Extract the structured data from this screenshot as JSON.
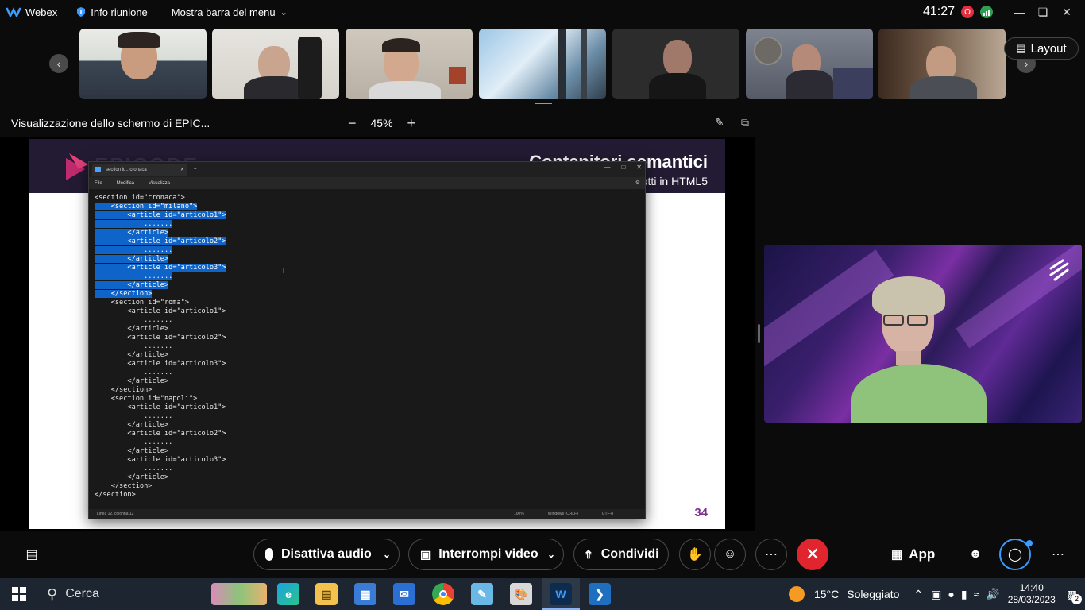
{
  "titlebar": {
    "app_name": "Webex",
    "meeting_info": "Info riunione",
    "menu_bar": "Mostra barra del menu",
    "timer": "41:27",
    "rec_badge": "O"
  },
  "strip": {
    "layout_label": "Layout"
  },
  "share": {
    "header": "Visualizzazione dello schermo di EPIC...",
    "zoom": "45%"
  },
  "slide": {
    "brand": "EPICODE",
    "title": "Contenitori semantici",
    "subtitle": "otti in HTML5",
    "page_number": "34"
  },
  "notepad": {
    "tab_title": "section id...cronaca",
    "menu": [
      "File",
      "Modifica",
      "Visualizza"
    ],
    "code": [
      {
        "indent": "",
        "text": "<section id=\"cronaca\">",
        "sel": false
      },
      {
        "indent": "    ",
        "text": "<section id=\"milano\">",
        "sel": true
      },
      {
        "indent": "        ",
        "text": "<article id=\"articolo1\">",
        "sel": true
      },
      {
        "indent": "            ",
        "text": ".......",
        "sel": true
      },
      {
        "indent": "        ",
        "text": "</article>",
        "sel": true
      },
      {
        "indent": "        ",
        "text": "<article id=\"articolo2\">",
        "sel": true
      },
      {
        "indent": "            ",
        "text": ".......",
        "sel": true
      },
      {
        "indent": "        ",
        "text": "</article>",
        "sel": true
      },
      {
        "indent": "        ",
        "text": "<article id=\"articolo3\">",
        "sel": true
      },
      {
        "indent": "            ",
        "text": ".......",
        "sel": true
      },
      {
        "indent": "        ",
        "text": "</article>",
        "sel": true
      },
      {
        "indent": "    ",
        "text": "</section>",
        "sel": true
      },
      {
        "indent": "    ",
        "text": "<section id=\"roma\">",
        "sel": false
      },
      {
        "indent": "        ",
        "text": "<article id=\"articolo1\">",
        "sel": false
      },
      {
        "indent": "            ",
        "text": ".......",
        "sel": false
      },
      {
        "indent": "        ",
        "text": "</article>",
        "sel": false
      },
      {
        "indent": "        ",
        "text": "<article id=\"articolo2\">",
        "sel": false
      },
      {
        "indent": "            ",
        "text": ".......",
        "sel": false
      },
      {
        "indent": "        ",
        "text": "</article>",
        "sel": false
      },
      {
        "indent": "        ",
        "text": "<article id=\"articolo3\">",
        "sel": false
      },
      {
        "indent": "            ",
        "text": ".......",
        "sel": false
      },
      {
        "indent": "        ",
        "text": "</article>",
        "sel": false
      },
      {
        "indent": "    ",
        "text": "</section>",
        "sel": false
      },
      {
        "indent": "    ",
        "text": "<section id=\"napoli\">",
        "sel": false
      },
      {
        "indent": "        ",
        "text": "<article id=\"articolo1\">",
        "sel": false
      },
      {
        "indent": "            ",
        "text": ".......",
        "sel": false
      },
      {
        "indent": "        ",
        "text": "</article>",
        "sel": false
      },
      {
        "indent": "        ",
        "text": "<article id=\"articolo2\">",
        "sel": false
      },
      {
        "indent": "            ",
        "text": ".......",
        "sel": false
      },
      {
        "indent": "        ",
        "text": "</article>",
        "sel": false
      },
      {
        "indent": "        ",
        "text": "<article id=\"articolo3\">",
        "sel": false
      },
      {
        "indent": "            ",
        "text": ".......",
        "sel": false
      },
      {
        "indent": "        ",
        "text": "</article>",
        "sel": false
      },
      {
        "indent": "    ",
        "text": "</section>",
        "sel": false
      },
      {
        "indent": "",
        "text": "</section>",
        "sel": false
      }
    ],
    "status": {
      "position": "Linea 12, colonna 12",
      "zoom": "100%",
      "eol": "Windows (CRLF)",
      "encoding": "UTF-8"
    }
  },
  "controls": {
    "mute": "Disattiva audio",
    "video": "Interrompi video",
    "share": "Condividi",
    "apps": "App"
  },
  "taskbar": {
    "search": "Cerca",
    "temperature": "15°C",
    "weather": "Soleggiato",
    "time": "14:40",
    "date": "28/03/2023",
    "notifications": "2"
  },
  "colors": {
    "end_call": "#e0252f",
    "selection": "#0e64c8",
    "slide_header": "#231b33"
  }
}
